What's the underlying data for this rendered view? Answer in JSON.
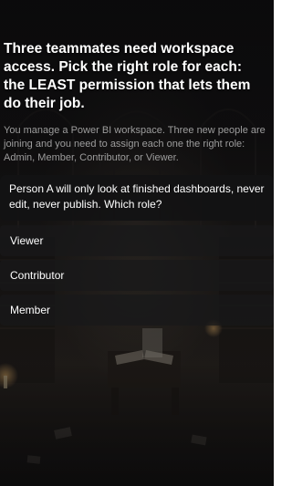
{
  "quiz": {
    "title": "Three teammates need workspace access. Pick the right role for each: the LEAST permission that lets them do their job.",
    "description": "You manage a Power BI workspace. Three new people are joining and you need to assign each one the right role: Admin, Member, Contributor, or Viewer.",
    "question": "Person A will only look at finished dashboards, never edit, never publish. Which role?",
    "options": [
      {
        "label": "Viewer"
      },
      {
        "label": "Contributor"
      },
      {
        "label": "Member"
      }
    ]
  },
  "colors": {
    "title_text": "#ffffff",
    "description_text": "#9d9d9d",
    "panel_background": "#121214",
    "option_background": "#18181a"
  }
}
